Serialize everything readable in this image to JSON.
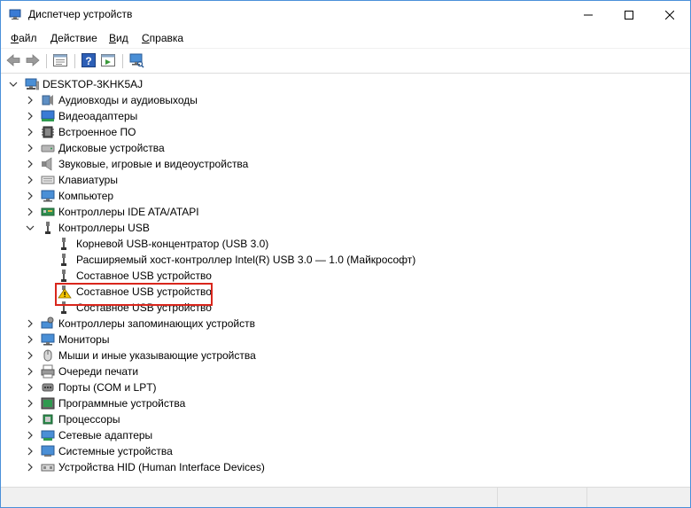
{
  "window": {
    "title": "Диспетчер устройств"
  },
  "menu": [
    "Файл",
    "Действие",
    "Вид",
    "Справка"
  ],
  "menu_accel": [
    "Ф",
    "Д",
    "В",
    "С"
  ],
  "tree": {
    "root": "DESKTOP-3KHK5AJ",
    "categories": [
      "Аудиовходы и аудиовыходы",
      "Видеоадаптеры",
      "Встроенное ПО",
      "Дисковые устройства",
      "Звуковые, игровые и видеоустройства",
      "Клавиатуры",
      "Компьютер",
      "Контроллеры IDE ATA/ATAPI",
      "Контроллеры USB",
      "Контроллеры запоминающих устройств",
      "Мониторы",
      "Мыши и иные указывающие устройства",
      "Очереди печати",
      "Порты (COM и LPT)",
      "Программные устройства",
      "Процессоры",
      "Сетевые адаптеры",
      "Системные устройства",
      "Устройства HID (Human Interface Devices)"
    ],
    "usb_children": [
      "Корневой USB-концентратор (USB 3.0)",
      "Расширяемый хост-контроллер Intel(R) USB 3.0 — 1.0 (Майкрософт)",
      "Составное USB устройство",
      "Составное USB устройство",
      "Составное USB устройство"
    ],
    "expanded_category": "Контроллеры USB",
    "warning_device_index": 3
  },
  "colors": {
    "highlight": "#d9261c",
    "warning": "#f5c400",
    "accent": "#4a90d9"
  }
}
